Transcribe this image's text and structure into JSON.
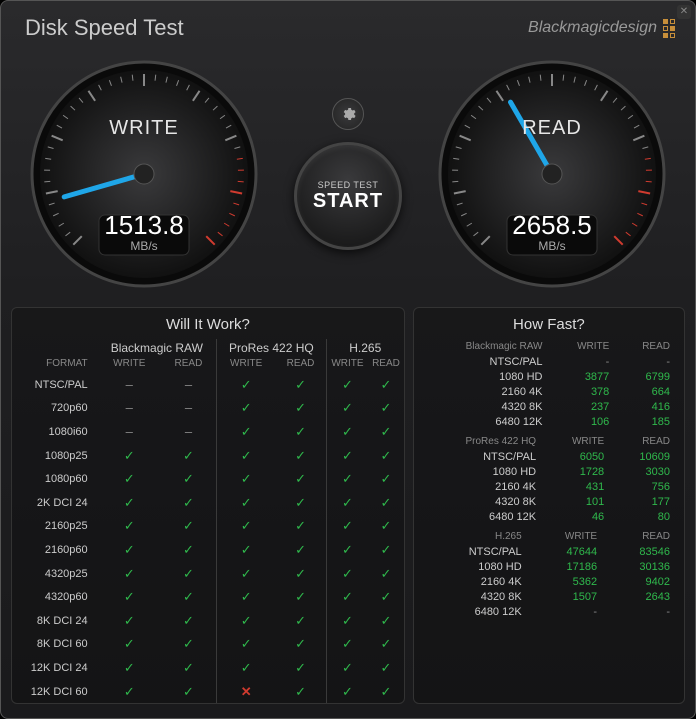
{
  "app": {
    "title": "Disk Speed Test",
    "brand": "Blackmagicdesign"
  },
  "gauges": {
    "write": {
      "label": "WRITE",
      "value": "1513.8",
      "unit": "MB/s",
      "angle_deg": -196
    },
    "read": {
      "label": "READ",
      "value": "2658.5",
      "unit": "MB/s",
      "angle_deg": -120
    }
  },
  "start_button": {
    "top": "SPEED TEST",
    "main": "START"
  },
  "will_it_work": {
    "title": "Will It Work?",
    "header_format": "FORMAT",
    "codecs": [
      "Blackmagic RAW",
      "ProRes 422 HQ",
      "H.265"
    ],
    "sub_headers": [
      "WRITE",
      "READ"
    ],
    "rows": [
      {
        "format": "NTSC/PAL",
        "cells": [
          "-",
          "-",
          "y",
          "y",
          "y",
          "y"
        ]
      },
      {
        "format": "720p60",
        "cells": [
          "-",
          "-",
          "y",
          "y",
          "y",
          "y"
        ]
      },
      {
        "format": "1080i60",
        "cells": [
          "-",
          "-",
          "y",
          "y",
          "y",
          "y"
        ]
      },
      {
        "format": "1080p25",
        "cells": [
          "y",
          "y",
          "y",
          "y",
          "y",
          "y"
        ]
      },
      {
        "format": "1080p60",
        "cells": [
          "y",
          "y",
          "y",
          "y",
          "y",
          "y"
        ]
      },
      {
        "format": "2K DCI 24",
        "cells": [
          "y",
          "y",
          "y",
          "y",
          "y",
          "y"
        ]
      },
      {
        "format": "2160p25",
        "cells": [
          "y",
          "y",
          "y",
          "y",
          "y",
          "y"
        ]
      },
      {
        "format": "2160p60",
        "cells": [
          "y",
          "y",
          "y",
          "y",
          "y",
          "y"
        ]
      },
      {
        "format": "4320p25",
        "cells": [
          "y",
          "y",
          "y",
          "y",
          "y",
          "y"
        ]
      },
      {
        "format": "4320p60",
        "cells": [
          "y",
          "y",
          "y",
          "y",
          "y",
          "y"
        ]
      },
      {
        "format": "8K DCI 24",
        "cells": [
          "y",
          "y",
          "y",
          "y",
          "y",
          "y"
        ]
      },
      {
        "format": "8K DCI 60",
        "cells": [
          "y",
          "y",
          "y",
          "y",
          "y",
          "y"
        ]
      },
      {
        "format": "12K DCI 24",
        "cells": [
          "y",
          "y",
          "y",
          "y",
          "y",
          "y"
        ]
      },
      {
        "format": "12K DCI 60",
        "cells": [
          "y",
          "y",
          "x",
          "y",
          "y",
          "y"
        ]
      }
    ]
  },
  "how_fast": {
    "title": "How Fast?",
    "sub_headers": [
      "WRITE",
      "READ"
    ],
    "sections": [
      {
        "codec": "Blackmagic RAW",
        "rows": [
          {
            "res": "NTSC/PAL",
            "write": "-",
            "read": "-"
          },
          {
            "res": "1080 HD",
            "write": "3877",
            "read": "6799"
          },
          {
            "res": "2160 4K",
            "write": "378",
            "read": "664"
          },
          {
            "res": "4320 8K",
            "write": "237",
            "read": "416"
          },
          {
            "res": "6480 12K",
            "write": "106",
            "read": "185"
          }
        ]
      },
      {
        "codec": "ProRes 422 HQ",
        "rows": [
          {
            "res": "NTSC/PAL",
            "write": "6050",
            "read": "10609"
          },
          {
            "res": "1080 HD",
            "write": "1728",
            "read": "3030"
          },
          {
            "res": "2160 4K",
            "write": "431",
            "read": "756"
          },
          {
            "res": "4320 8K",
            "write": "101",
            "read": "177"
          },
          {
            "res": "6480 12K",
            "write": "46",
            "read": "80"
          }
        ]
      },
      {
        "codec": "H.265",
        "rows": [
          {
            "res": "NTSC/PAL",
            "write": "47644",
            "read": "83546"
          },
          {
            "res": "1080 HD",
            "write": "17186",
            "read": "30136"
          },
          {
            "res": "2160 4K",
            "write": "5362",
            "read": "9402"
          },
          {
            "res": "4320 8K",
            "write": "1507",
            "read": "2643"
          },
          {
            "res": "6480 12K",
            "write": "-",
            "read": "-"
          }
        ]
      }
    ]
  }
}
